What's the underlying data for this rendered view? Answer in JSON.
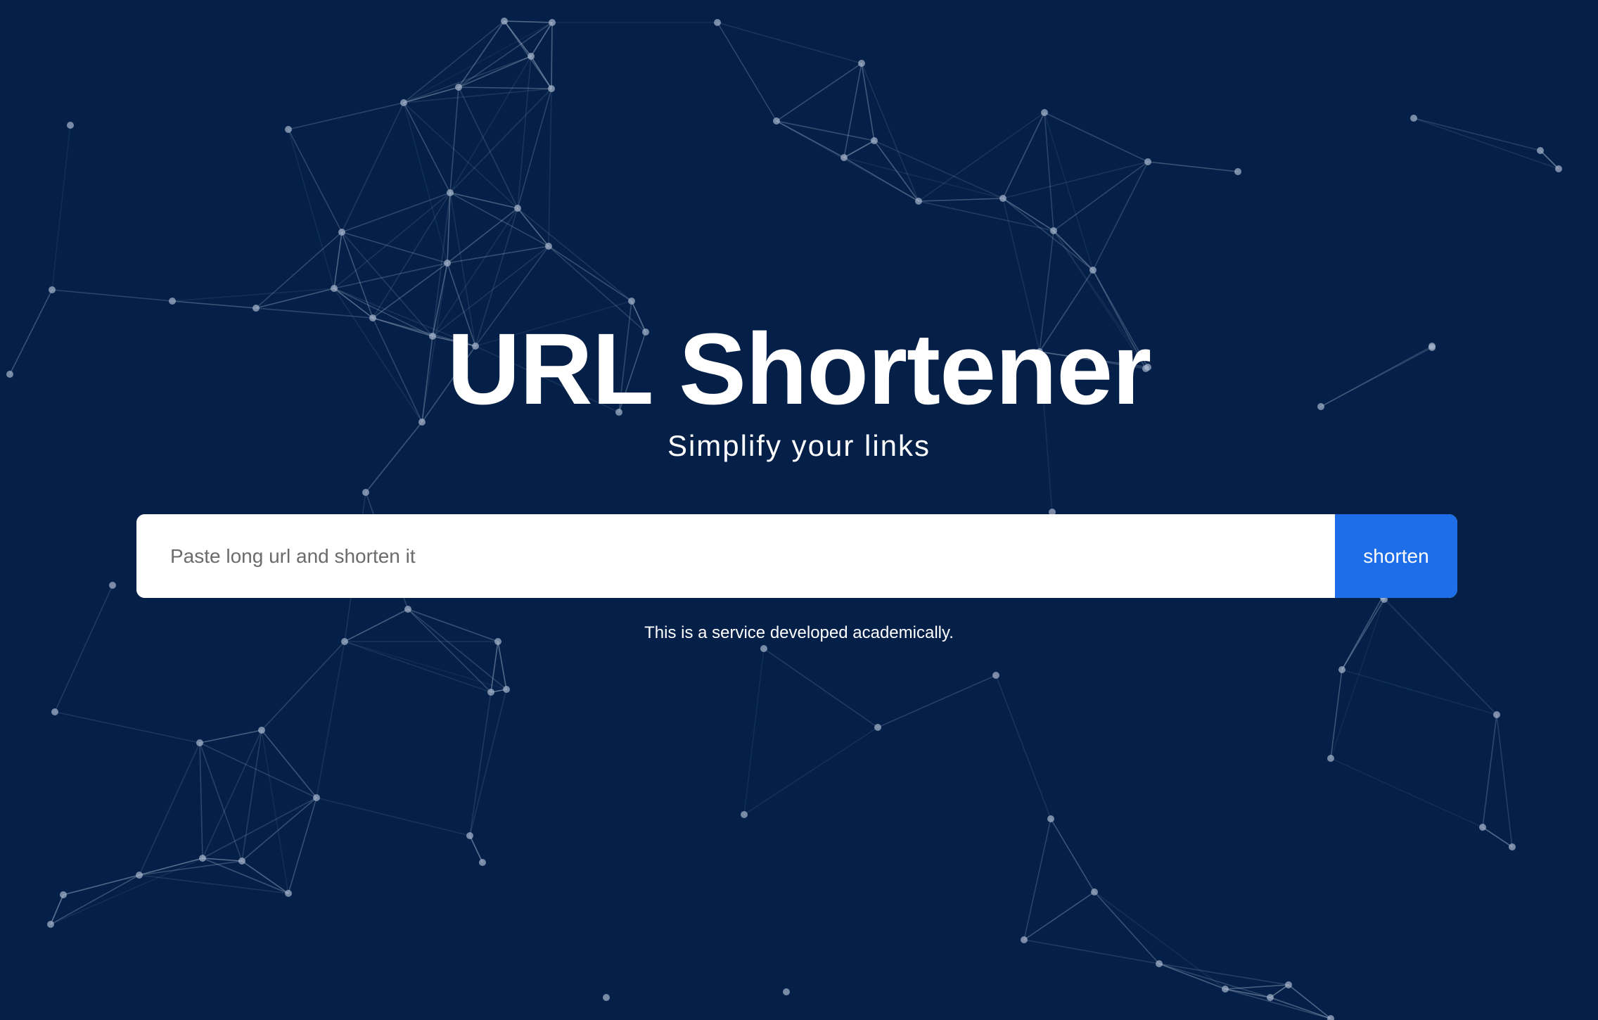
{
  "header": {
    "title": "URL Shortener",
    "subtitle": "Simplify your links"
  },
  "form": {
    "input_placeholder": "Paste long url and shorten it",
    "input_value": "",
    "button_label": "shorten"
  },
  "footer": {
    "note": "This is a service developed academically."
  },
  "colors": {
    "background": "#042048",
    "button": "#1d6ee8",
    "network_lines": "#a9b8cf"
  }
}
